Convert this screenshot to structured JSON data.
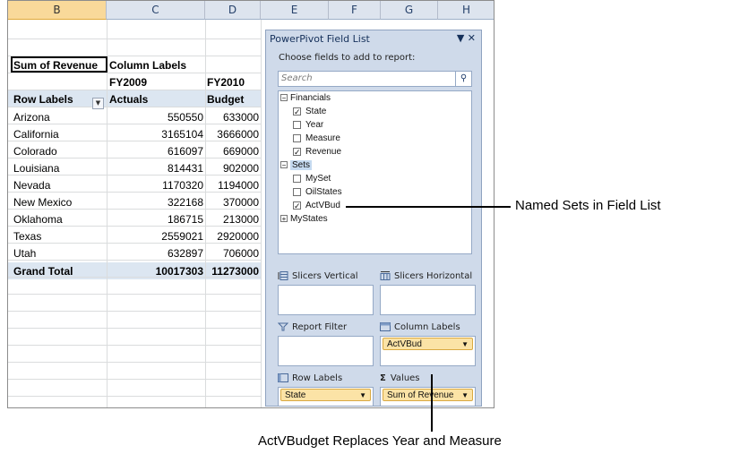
{
  "columns": [
    "B",
    "C",
    "D",
    "E",
    "F",
    "G",
    "H"
  ],
  "pivot": {
    "corner": "Sum of Revenue",
    "col_labels": "Column Labels",
    "fy2009": "FY2009",
    "fy2010": "FY2010",
    "row_labels": "Row Labels",
    "actuals": "Actuals",
    "budget": "Budget",
    "filter_glyph": "▼",
    "rows": [
      {
        "state": "Arizona",
        "a": "550550",
        "b": "633000"
      },
      {
        "state": "California",
        "a": "3165104",
        "b": "3666000"
      },
      {
        "state": "Colorado",
        "a": "616097",
        "b": "669000"
      },
      {
        "state": "Louisiana",
        "a": "814431",
        "b": "902000"
      },
      {
        "state": "Nevada",
        "a": "1170320",
        "b": "1194000"
      },
      {
        "state": "New Mexico",
        "a": "322168",
        "b": "370000"
      },
      {
        "state": "Oklahoma",
        "a": "186715",
        "b": "213000"
      },
      {
        "state": "Texas",
        "a": "2559021",
        "b": "2920000"
      },
      {
        "state": "Utah",
        "a": "632897",
        "b": "706000"
      }
    ],
    "total_label": "Grand Total",
    "total_a": "10017303",
    "total_b": "11273000"
  },
  "pane": {
    "title": "PowerPivot Field List",
    "controls": "▼ ✕",
    "choose": "Choose fields to add to report:",
    "search_placeholder": "Search",
    "search_icon": "⚲",
    "tree": {
      "financials": "Financials",
      "state": "State",
      "year": "Year",
      "measure": "Measure",
      "revenue": "Revenue",
      "sets": "Sets",
      "myset": "MySet",
      "oilstates": "OilStates",
      "actvbud": "ActVBud",
      "mystates": "MyStates",
      "minus": "−",
      "plus": "+",
      "check": "✓"
    },
    "zones": {
      "slicers_vertical": "Slicers Vertical",
      "slicers_horizontal": "Slicers Horizontal",
      "report_filter": "Report Filter",
      "column_labels": "Column Labels",
      "row_labels": "Row Labels",
      "values": "Values",
      "values_sigma": "Σ",
      "col_pill": "ActVBud",
      "row_pill": "State",
      "val_pill": "Sum of Revenue",
      "dd": "▼"
    }
  },
  "callouts": {
    "named_sets": "Named Sets in Field List",
    "replaces": "ActVBudget Replaces Year and Measure"
  }
}
